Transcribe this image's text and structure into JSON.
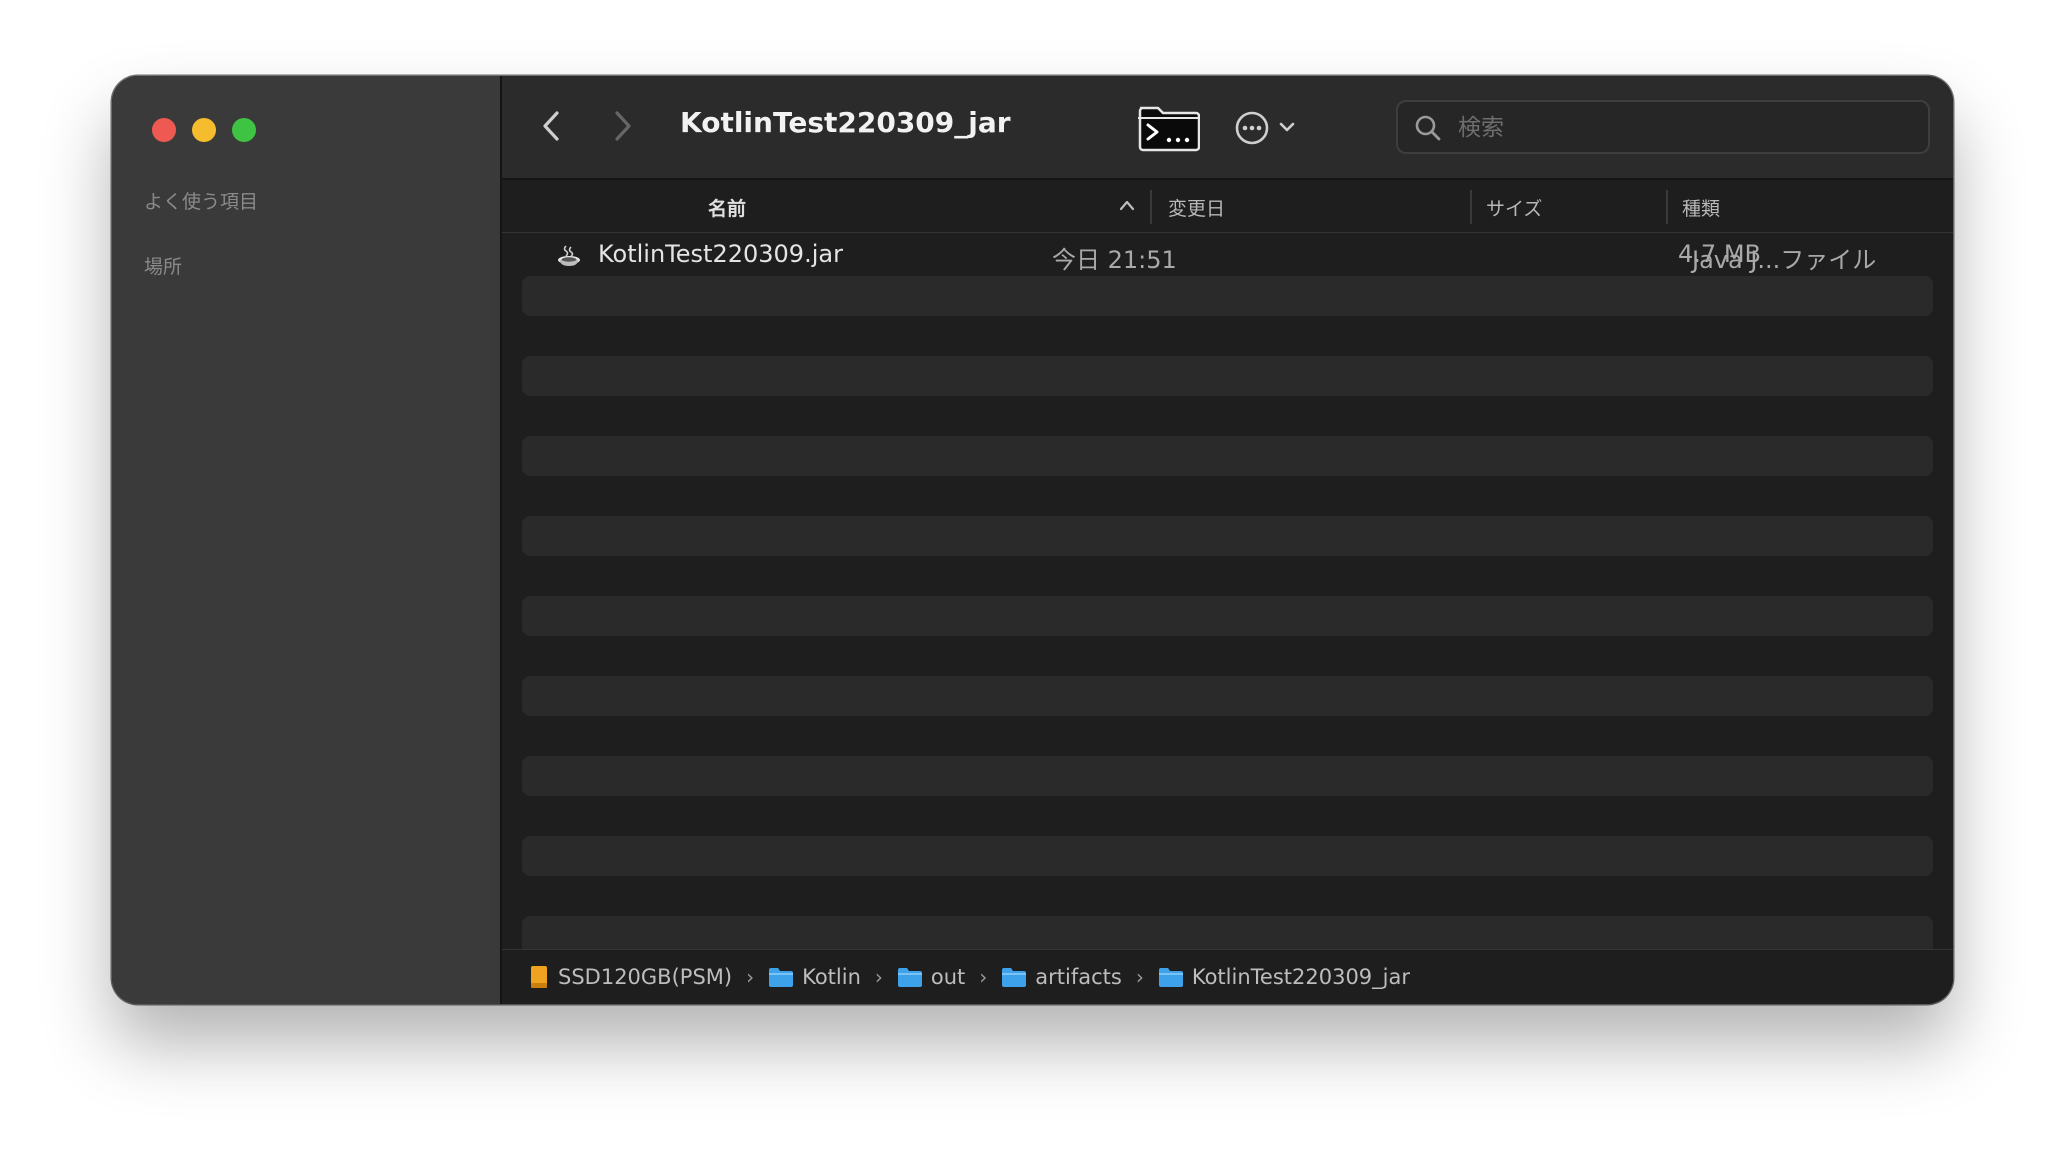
{
  "window": {
    "title": "KotlinTest220309_jar"
  },
  "sidebar": {
    "sections": [
      "よく使う項目",
      "場所"
    ]
  },
  "toolbar": {
    "back_icon": "chevron-left-icon",
    "forward_icon": "chevron-right-icon",
    "terminal_icon": "terminal-icon",
    "more_icon": "ellipsis-circle-icon",
    "search_placeholder": "検索"
  },
  "columns": [
    "名前",
    "変更日",
    "サイズ",
    "種類"
  ],
  "files": [
    {
      "name": "KotlinTest220309.jar",
      "modified": "今日 21:51",
      "size": "4.7 MB",
      "kind": "Java J...ファイル",
      "icon": "java-cup-icon"
    }
  ],
  "pathbar": [
    {
      "label": "SSD120GB(PSM)",
      "icon": "drive-icon"
    },
    {
      "label": "Kotlin",
      "icon": "folder-icon"
    },
    {
      "label": "out",
      "icon": "folder-icon"
    },
    {
      "label": "artifacts",
      "icon": "folder-icon"
    },
    {
      "label": "KotlinTest220309_jar",
      "icon": "folder-icon"
    }
  ],
  "colors": {
    "close": "#ee5a52",
    "minimize": "#f5bd2e",
    "maximize": "#3ec342",
    "folder": "#3ea2ea",
    "drive": "#f0a320"
  }
}
